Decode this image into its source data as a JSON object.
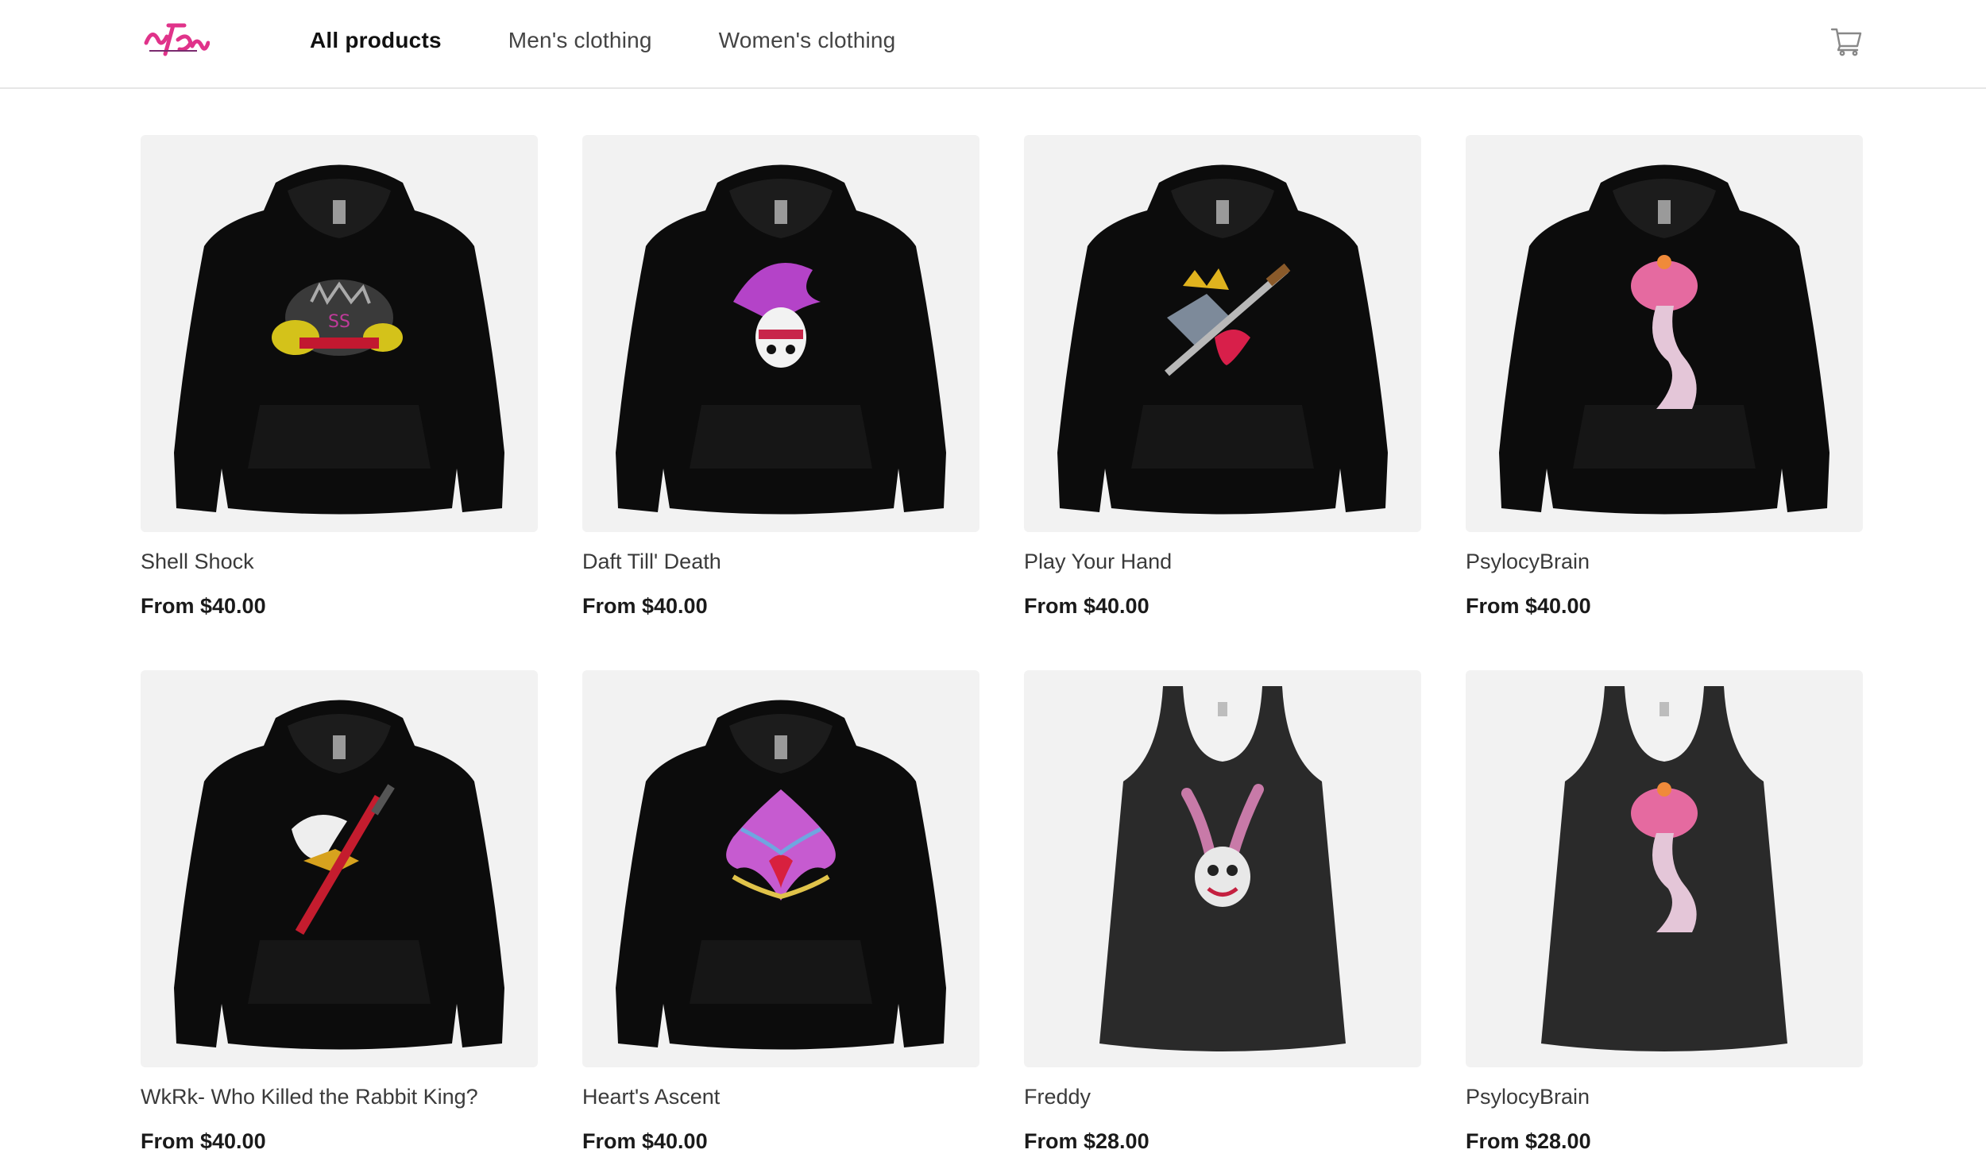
{
  "brand": {
    "logo_icon": "brand-logo",
    "accent": "#e0338a"
  },
  "nav": {
    "items": [
      {
        "label": "All products",
        "active": true
      },
      {
        "label": "Men's clothing",
        "active": false
      },
      {
        "label": "Women's clothing",
        "active": false
      }
    ]
  },
  "cart": {
    "icon": "cart-icon"
  },
  "products": [
    {
      "title": "Shell Shock",
      "price": "From $40.00",
      "garment": "hoodie",
      "design": "spiked turtle shell graphic"
    },
    {
      "title": "Daft Till' Death",
      "price": "From $40.00",
      "garment": "hoodie",
      "design": "punk skull with mohawk graphic"
    },
    {
      "title": "Play Your Hand",
      "price": "From $40.00",
      "garment": "hoodie",
      "design": "crown, heart and sword graphic"
    },
    {
      "title": "PsylocyBrain",
      "price": "From $40.00",
      "garment": "hoodie",
      "design": "mushroom brain graphic"
    },
    {
      "title": "WkRk- Who Killed the Rabbit King?",
      "price": "From $40.00",
      "garment": "hoodie",
      "design": "rabbit, crown and sword graphic"
    },
    {
      "title": "Heart's Ascent",
      "price": "From $40.00",
      "garment": "hoodie",
      "design": "feathered heart graphic"
    },
    {
      "title": "Freddy",
      "price": "From $28.00",
      "garment": "tank",
      "design": "rabbit head graphic"
    },
    {
      "title": "PsylocyBrain",
      "price": "From $28.00",
      "garment": "tank",
      "design": "mushroom brain graphic"
    }
  ]
}
